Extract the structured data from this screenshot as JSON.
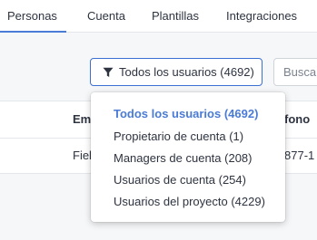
{
  "tabs": [
    {
      "label": "Personas",
      "active": true
    },
    {
      "label": "Cuenta"
    },
    {
      "label": "Plantillas"
    },
    {
      "label": "Integraciones"
    }
  ],
  "filter": {
    "label": "Todos los usuarios (4692)",
    "icon": "filter-funnel-icon",
    "accent": "#3b6fd1"
  },
  "search": {
    "placeholder": "Buscar"
  },
  "table": {
    "headers": [
      "Emp",
      "fono"
    ],
    "row": [
      "Fiel",
      "877-1"
    ]
  },
  "dropdown": {
    "options": [
      {
        "label": "Todos los usuarios (4692)",
        "selected": true
      },
      {
        "label": "Propietario de cuenta (1)"
      },
      {
        "label": "Managers de cuenta (208)"
      },
      {
        "label": "Usuarios de cuenta (254)"
      },
      {
        "label": "Usuarios del proyecto (4229)"
      }
    ],
    "selected_color": "#4a7bd6"
  }
}
